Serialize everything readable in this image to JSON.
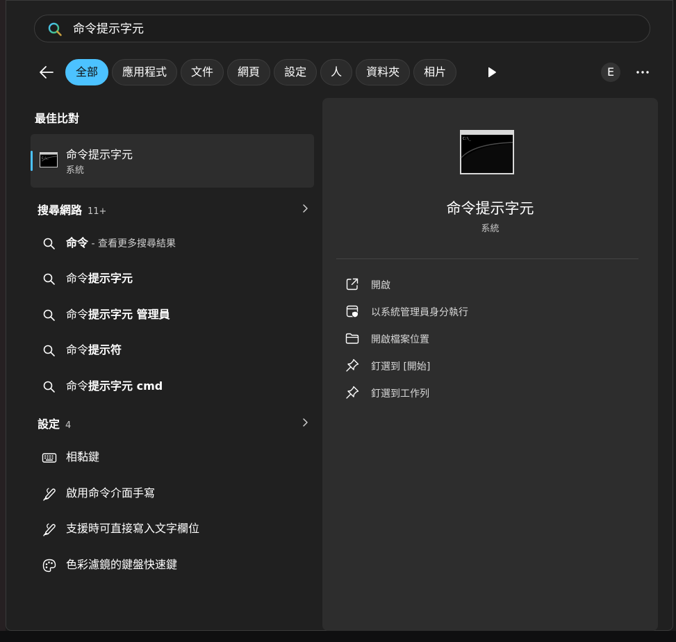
{
  "search": {
    "query": "命令提示字元"
  },
  "filters": [
    {
      "label": "全部",
      "active": true
    },
    {
      "label": "應用程式"
    },
    {
      "label": "文件"
    },
    {
      "label": "網頁"
    },
    {
      "label": "設定"
    },
    {
      "label": "人"
    },
    {
      "label": "資料夾"
    },
    {
      "label": "相片"
    }
  ],
  "account": {
    "initial": "E"
  },
  "best_match": {
    "heading": "最佳比對",
    "title": "命令提示字元",
    "subtitle": "系統"
  },
  "web_search": {
    "heading": "搜尋網路",
    "count": "11+",
    "items": [
      {
        "prefix": "命令",
        "rest": "",
        "hint": " - 查看更多搜尋結果"
      },
      {
        "prefix": "命令",
        "rest": "提示字元",
        "hint": ""
      },
      {
        "prefix": "命令",
        "rest": "提示字元 管理員",
        "hint": ""
      },
      {
        "prefix": "命令",
        "rest": "提示符",
        "hint": ""
      },
      {
        "prefix": "命令",
        "rest": "提示字元 cmd",
        "hint": ""
      }
    ]
  },
  "settings": {
    "heading": "設定",
    "count": "4",
    "items": [
      {
        "label": "相黏鍵",
        "icon": "keyboard-icon"
      },
      {
        "label": "啟用命令介面手寫",
        "icon": "pen-icon"
      },
      {
        "label": "支援時可直接寫入文字欄位",
        "icon": "pen-icon"
      },
      {
        "label": "色彩濾鏡的鍵盤快速鍵",
        "icon": "palette-icon"
      }
    ]
  },
  "preview": {
    "title": "命令提示字元",
    "subtitle": "系統",
    "actions": [
      {
        "label": "開啟",
        "icon": "open-external-icon"
      },
      {
        "label": "以系統管理員身分執行",
        "icon": "shield-icon"
      },
      {
        "label": "開啟檔案位置",
        "icon": "folder-icon"
      },
      {
        "label": "釘選到 [開始]",
        "icon": "pin-icon"
      },
      {
        "label": "釘選到工作列",
        "icon": "pin-icon"
      }
    ]
  },
  "colors": {
    "accent": "#4cc2ff",
    "panel": "#2d2d2d",
    "window": "#202020"
  }
}
